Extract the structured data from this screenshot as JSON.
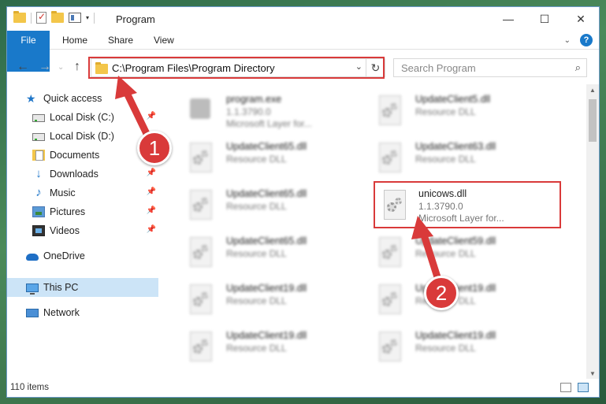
{
  "window": {
    "title": "Program",
    "controls": {
      "minimize": "—",
      "maximize": "☐",
      "close": "✕"
    }
  },
  "ribbon": {
    "tabs": [
      "File",
      "Home",
      "Share",
      "View"
    ],
    "help": "?"
  },
  "nav": {
    "address": "C:\\Program Files\\Program Directory",
    "search_placeholder": "Search Program"
  },
  "sidebar": {
    "items": [
      {
        "label": "Quick access",
        "icon": "star-icon",
        "pinned": false
      },
      {
        "label": "Local Disk (C:)",
        "icon": "disk-icon",
        "pinned": true
      },
      {
        "label": "Local Disk (D:)",
        "icon": "disk-icon",
        "pinned": false
      },
      {
        "label": "Documents",
        "icon": "documents-icon",
        "pinned": true
      },
      {
        "label": "Downloads",
        "icon": "download-icon",
        "pinned": true
      },
      {
        "label": "Music",
        "icon": "music-icon",
        "pinned": true
      },
      {
        "label": "Pictures",
        "icon": "pictures-icon",
        "pinned": true
      },
      {
        "label": "Videos",
        "icon": "video-icon",
        "pinned": true
      },
      {
        "label": "OneDrive",
        "icon": "onedrive-icon",
        "pinned": false
      },
      {
        "label": "This PC",
        "icon": "pc-icon",
        "pinned": false,
        "selected": true
      },
      {
        "label": "Network",
        "icon": "network-icon",
        "pinned": false
      }
    ]
  },
  "files": [
    {
      "name": "program.exe",
      "line2": "1.1.3790.0",
      "line3": "Microsoft Layer for...",
      "type": "exe"
    },
    {
      "name": "UpdateClient5.dll",
      "line2": "Resource DLL",
      "line3": "",
      "type": "dll"
    },
    {
      "name": "UpdateClient65.dll",
      "line2": "Resource DLL",
      "line3": "",
      "type": "dll"
    },
    {
      "name": "UpdateClient63.dll",
      "line2": "Resource DLL",
      "line3": "",
      "type": "dll"
    },
    {
      "name": "UpdateClient65.dll",
      "line2": "Resource DLL",
      "line3": "",
      "type": "dll"
    },
    {
      "name": "unicows.dll",
      "line2": "1.1.3790.0",
      "line3": "Microsoft Layer for...",
      "type": "dll",
      "highlighted": true
    },
    {
      "name": "UpdateClient65.dll",
      "line2": "Resource DLL",
      "line3": "",
      "type": "dll"
    },
    {
      "name": "UpdateClient59.dll",
      "line2": "Resource DLL",
      "line3": "",
      "type": "dll"
    },
    {
      "name": "UpdateClient19.dll",
      "line2": "Resource DLL",
      "line3": "",
      "type": "dll"
    },
    {
      "name": "UpdateClient19.dll",
      "line2": "Resource DLL",
      "line3": "",
      "type": "dll"
    },
    {
      "name": "UpdateClient19.dll",
      "line2": "Resource DLL",
      "line3": "",
      "type": "dll"
    },
    {
      "name": "UpdateClient19.dll",
      "line2": "Resource DLL",
      "line3": "",
      "type": "dll"
    }
  ],
  "status": {
    "count": "110 items"
  },
  "annotations": {
    "badge1": "1",
    "badge2": "2",
    "accent": "#d93a3a"
  }
}
